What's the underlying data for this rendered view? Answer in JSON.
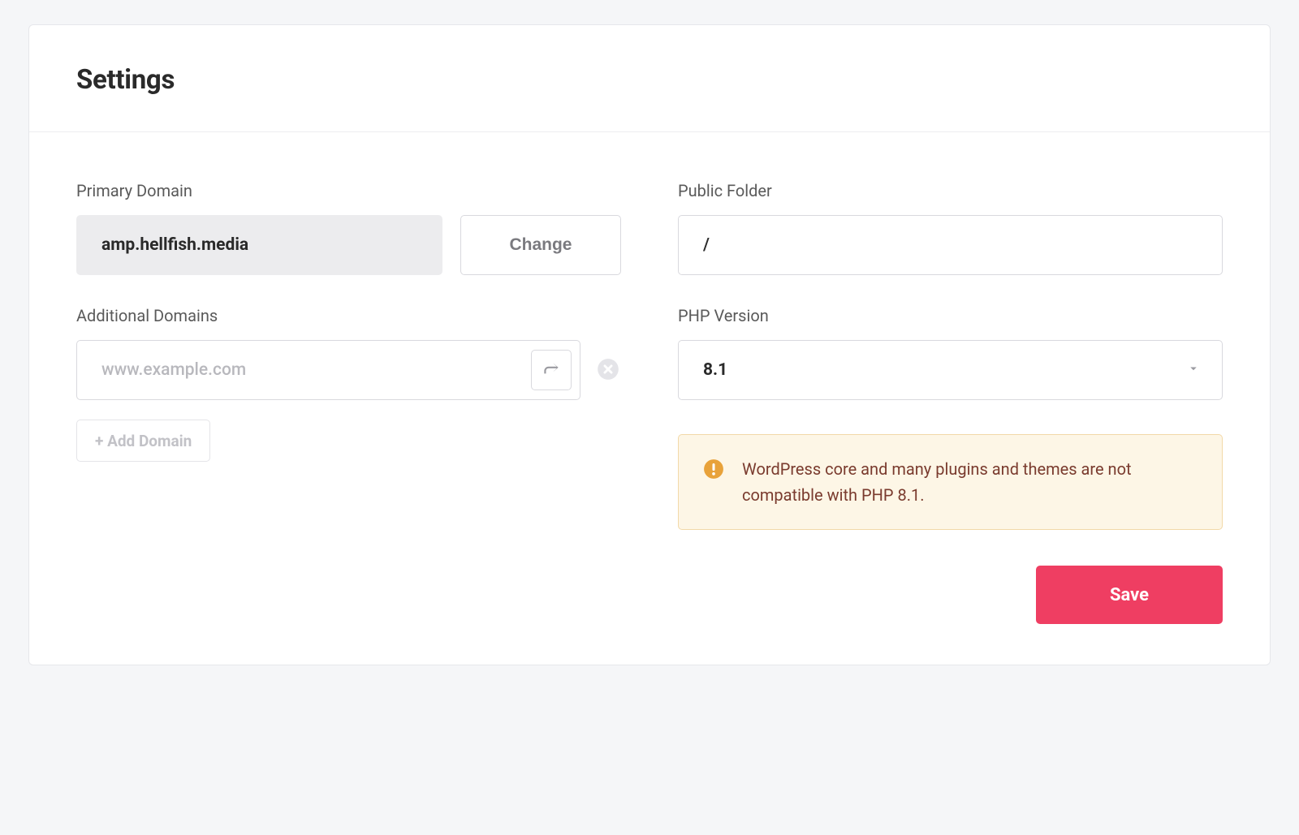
{
  "page_title": "Settings",
  "primary_domain": {
    "label": "Primary Domain",
    "value": "amp.hellfish.media",
    "change_label": "Change"
  },
  "additional_domains": {
    "label": "Additional Domains",
    "placeholder": "www.example.com",
    "add_label": "+ Add Domain"
  },
  "public_folder": {
    "label": "Public Folder",
    "value": "/"
  },
  "php_version": {
    "label": "PHP Version",
    "value": "8.1"
  },
  "warning": {
    "text": "WordPress core and many plugins and themes are not compatible with PHP 8.1."
  },
  "save_label": "Save"
}
